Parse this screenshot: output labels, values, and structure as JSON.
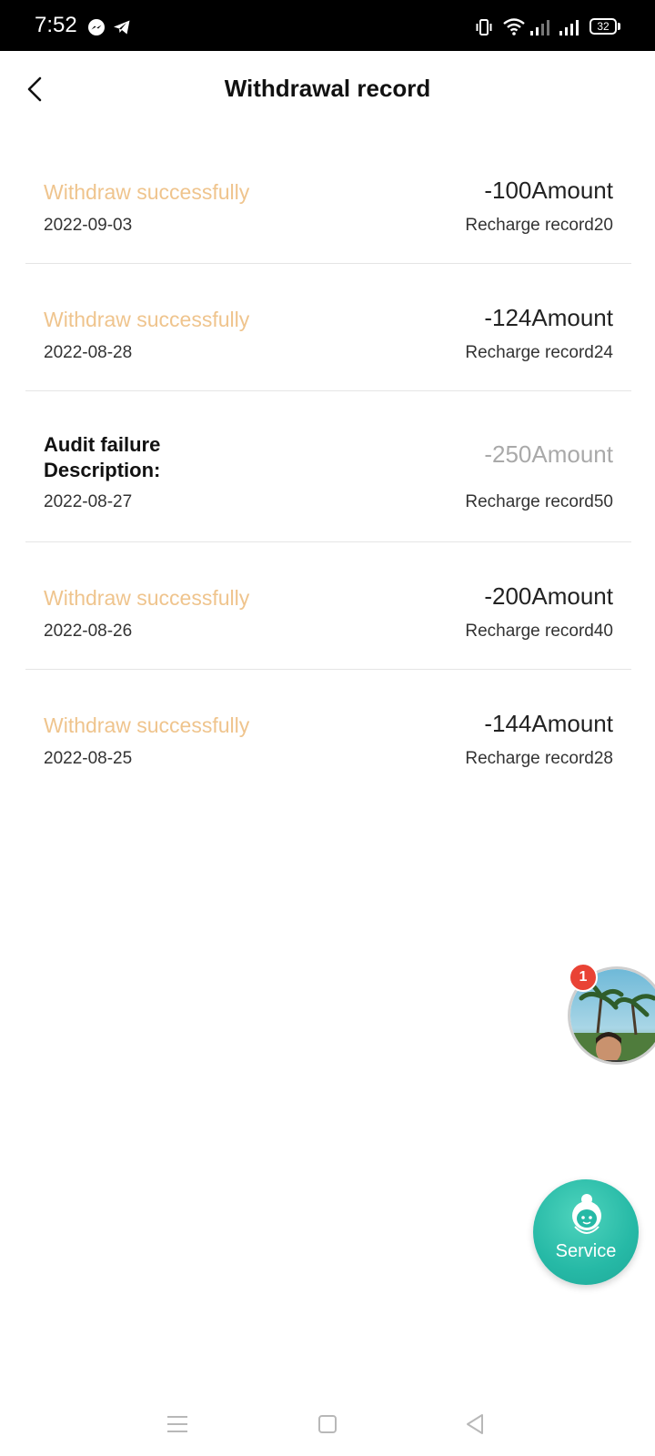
{
  "status_bar": {
    "time": "7:52",
    "battery": "32",
    "left_icons": [
      "messenger-icon",
      "telegram-icon"
    ],
    "right_icons": [
      "vibrate-icon",
      "wifi-icon",
      "signal-icon",
      "signal-icon",
      "battery-icon"
    ]
  },
  "header": {
    "title": "Withdrawal record",
    "back_icon": "chevron-left-icon"
  },
  "records": [
    {
      "status": "Withdraw successfully",
      "date": "2022-09-03",
      "amount": "-100Amount",
      "sub": "Recharge record20"
    },
    {
      "status": "Withdraw successfully",
      "date": "2022-08-28",
      "amount": "-124Amount",
      "sub": "Recharge record24"
    },
    {
      "status_line1": "Audit failure",
      "status_line2": "Description:",
      "date": "2022-08-27",
      "amount": "-250Amount",
      "sub": "Recharge record50"
    },
    {
      "status": "Withdraw successfully",
      "date": "2022-08-26",
      "amount": "-200Amount",
      "sub": "Recharge record40"
    },
    {
      "status": "Withdraw successfully",
      "date": "2022-08-25",
      "amount": "-144Amount",
      "sub": "Recharge record28"
    }
  ],
  "float_chat": {
    "badge": "1"
  },
  "service": {
    "label": "Service"
  },
  "nav": {
    "icons": [
      "menu-icon",
      "home-icon",
      "back-icon"
    ]
  },
  "colors": {
    "success_status": "#efc48d",
    "failed_amount": "#a9a9a9",
    "service_teal": "#26b9a6",
    "badge_red": "#e94335"
  }
}
